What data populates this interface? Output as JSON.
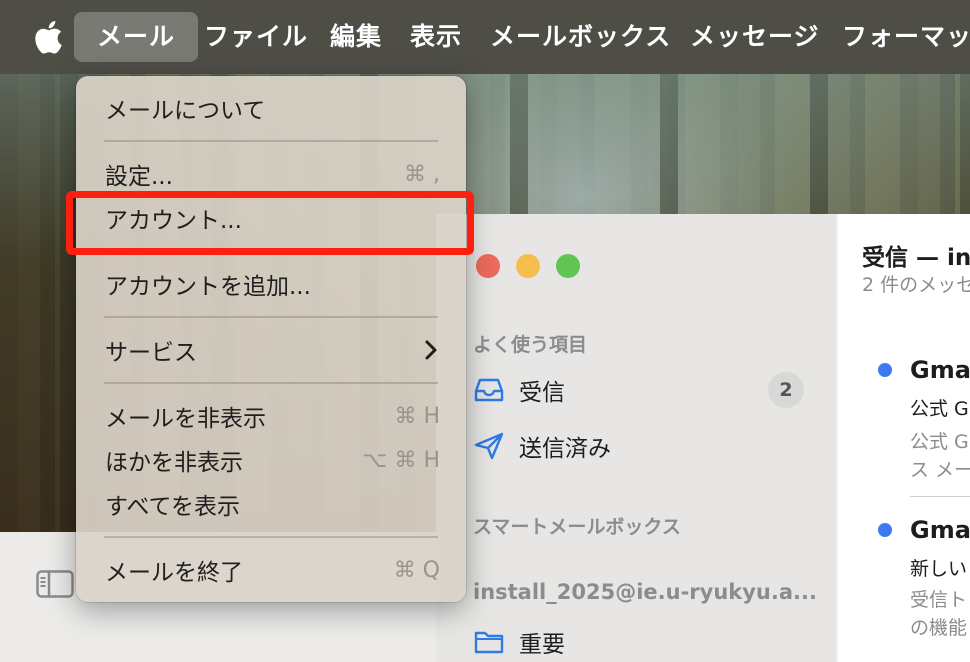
{
  "menubar": {
    "apple_icon": "apple-logo-icon",
    "items": [
      "メール",
      "ファイル",
      "編集",
      "表示",
      "メールボックス",
      "メッセージ",
      "フォーマット"
    ],
    "active_index": 0
  },
  "mail_menu": {
    "items": [
      {
        "label": "メールについて",
        "shortcut": ""
      },
      {
        "label": "設定...",
        "shortcut": "⌘ ,"
      },
      {
        "label": "アカウント...",
        "shortcut": ""
      },
      {
        "label": "アカウントを追加...",
        "shortcut": ""
      },
      {
        "label": "サービス",
        "shortcut": "",
        "submenu": true
      },
      {
        "label": "メールを非表示",
        "shortcut": "⌘ H"
      },
      {
        "label": "ほかを非表示",
        "shortcut": "⌥ ⌘ H"
      },
      {
        "label": "すべてを表示",
        "shortcut": ""
      },
      {
        "label": "メールを終了",
        "shortcut": "⌘ Q"
      }
    ],
    "highlighted_index": 2,
    "highlight_color": "#ff1f0f"
  },
  "mail_window": {
    "traffic_lights": {
      "close": "#ec6a5e",
      "minimize": "#f4bf4f",
      "zoom": "#61c554"
    },
    "sidebar": {
      "favorites_title": "よく使う項目",
      "inbox_label": "受信",
      "inbox_badge": "2",
      "sent_label": "送信済み",
      "smart_title": "スマートメールボックス",
      "account_title": "install_2025@ie.u-ryukyu.a...",
      "important_label": "重要"
    },
    "message_list": {
      "title": "受信 — in",
      "subtitle": "2 件のメッセ",
      "messages": [
        {
          "sender": "Gmai",
          "subject": "公式 G",
          "preview_line1": "公式 G",
          "preview_line2": "ス メー"
        },
        {
          "sender": "Gmai",
          "subject": "新しい",
          "preview_line1": "受信ト",
          "preview_line2": "の機能"
        }
      ],
      "unread_dot_color": "#3a7bf3"
    }
  }
}
